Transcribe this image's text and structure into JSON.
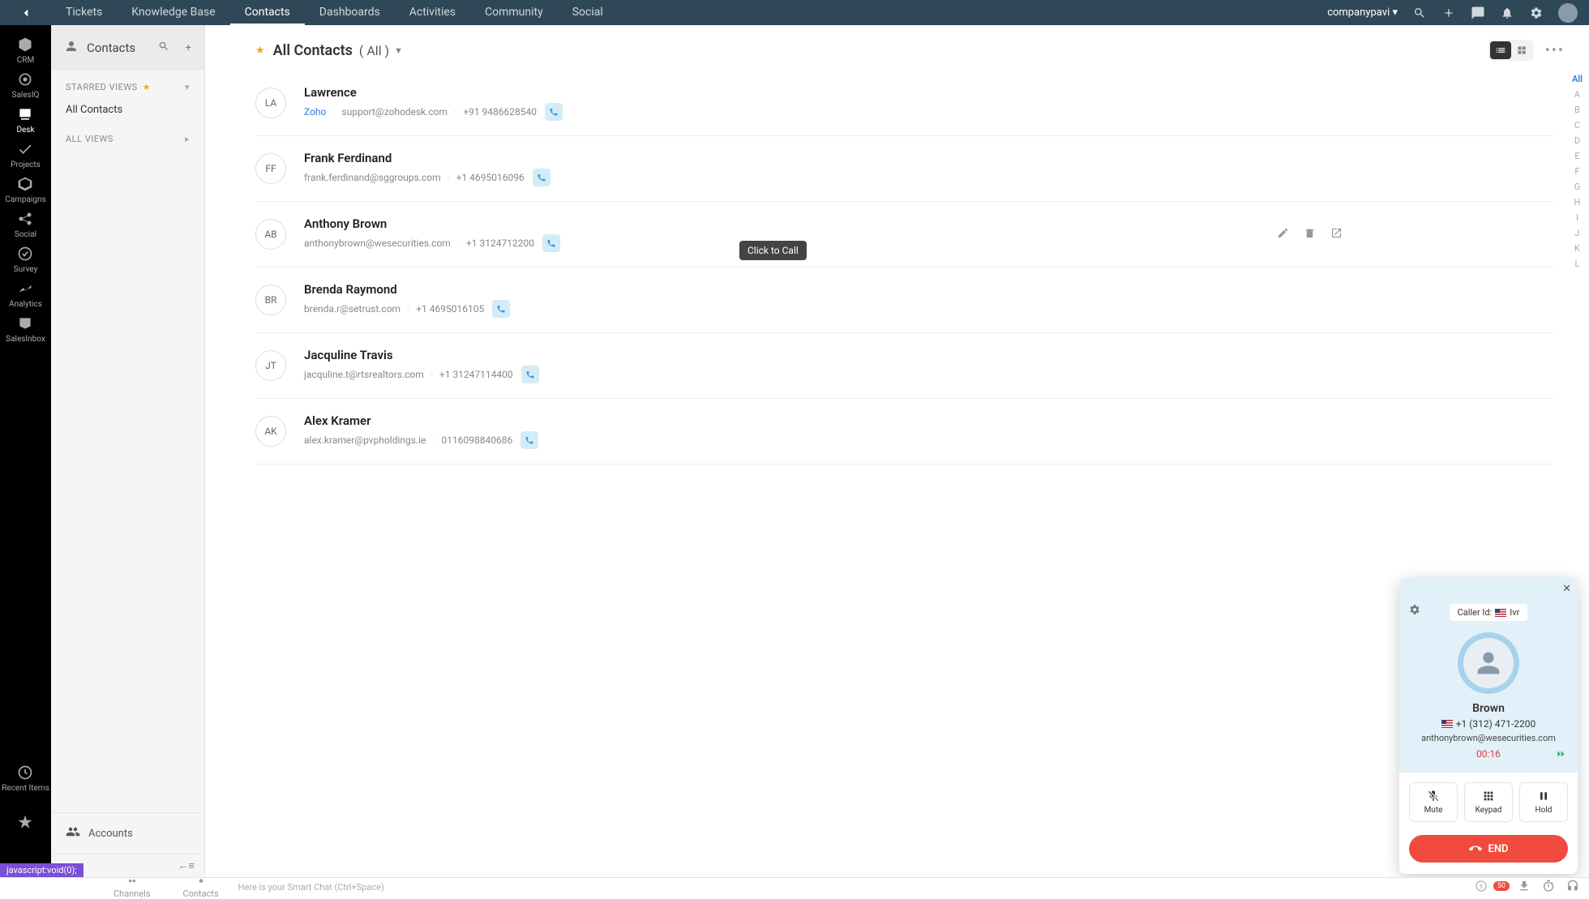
{
  "topbar": {
    "tabs": [
      "Tickets",
      "Knowledge Base",
      "Contacts",
      "Dashboards",
      "Activities",
      "Community",
      "Social"
    ],
    "active_tab": "Contacts",
    "user": "companypavi"
  },
  "left_rail": [
    {
      "key": "crm",
      "label": "CRM"
    },
    {
      "key": "salesiq",
      "label": "SalesIQ"
    },
    {
      "key": "desk",
      "label": "Desk"
    },
    {
      "key": "projects",
      "label": "Projects"
    },
    {
      "key": "campaigns",
      "label": "Campaigns"
    },
    {
      "key": "social",
      "label": "Social"
    },
    {
      "key": "survey",
      "label": "Survey"
    },
    {
      "key": "analytics",
      "label": "Analytics"
    },
    {
      "key": "salesinbox",
      "label": "SalesInbox"
    }
  ],
  "left_rail_bottom": [
    {
      "key": "recent",
      "label": "Recent Items"
    },
    {
      "key": "fav",
      "label": ""
    }
  ],
  "js_void": "javascript:void(0);",
  "side": {
    "title": "Contacts",
    "starred_label": "STARRED VIEWS",
    "all_contacts": "All Contacts",
    "all_views_label": "ALL VIEWS",
    "accounts": "Accounts"
  },
  "header": {
    "title": "All Contacts",
    "filter": "( All )"
  },
  "contacts": [
    {
      "initials": "LA",
      "name": "Lawrence",
      "org": "Zoho",
      "email": "support@zohodesk.com",
      "phone": "+91 9486628540",
      "has_org": true,
      "show_actions": false
    },
    {
      "initials": "FF",
      "name": "Frank Ferdinand",
      "org": "",
      "email": "frank.ferdinand@sggroups.com",
      "phone": "+1 4695016096",
      "has_org": false,
      "show_actions": false
    },
    {
      "initials": "AB",
      "name": "Anthony Brown",
      "org": "",
      "email": "anthonybrown@wesecurities.com",
      "phone": "+1 3124712200",
      "has_org": false,
      "show_actions": true
    },
    {
      "initials": "BR",
      "name": "Brenda Raymond",
      "org": "",
      "email": "brenda.r@setrust.com",
      "phone": "+1 4695016105",
      "has_org": false,
      "show_actions": false
    },
    {
      "initials": "JT",
      "name": "Jacquline Travis",
      "org": "",
      "email": "jacquline.t@rtsrealtors.com",
      "phone": "+1 31247114400",
      "has_org": false,
      "show_actions": false
    },
    {
      "initials": "AK",
      "name": "Alex Kramer",
      "org": "",
      "email": "alex.kramer@pvpholdings.ie",
      "phone": "0116098840686",
      "has_org": false,
      "show_actions": false
    }
  ],
  "tooltip": "Click to Call",
  "alpha": [
    "All",
    "A",
    "B",
    "C",
    "D",
    "E",
    "F",
    "G",
    "H",
    "I",
    "J",
    "K",
    "L"
  ],
  "call": {
    "caller_id_label": "Caller Id:",
    "caller_id_value": "Ivr",
    "name": "Brown",
    "phone": "+1 (312) 471-2200",
    "email": "anthonybrown@wesecurities.com",
    "timer": "00:16",
    "mute": "Mute",
    "keypad": "Keypad",
    "hold": "Hold",
    "end": "END"
  },
  "bottom": {
    "channels": "Channels",
    "contacts": "Contacts",
    "chat_placeholder": "Here is your Smart Chat (Ctrl+Space)"
  }
}
